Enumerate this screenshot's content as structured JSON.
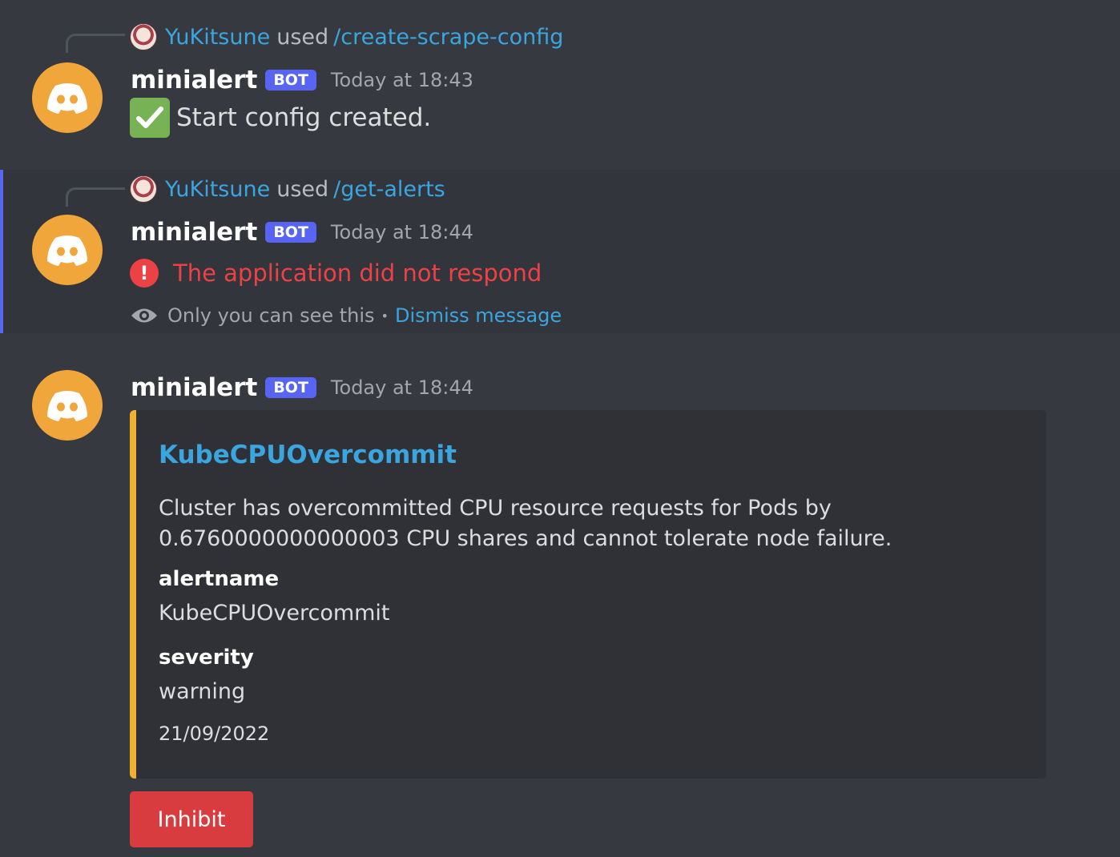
{
  "messages": [
    {
      "reply": {
        "user": "YuKitsune",
        "used": "used",
        "command": "/create-scrape-config"
      },
      "author": "minialert",
      "tag": "BOT",
      "timestamp": "Today at 18:43",
      "content": "Start config created.",
      "content_icon": "white-check-mark"
    },
    {
      "reply": {
        "user": "YuKitsune",
        "used": "used",
        "command": "/get-alerts"
      },
      "author": "minialert",
      "tag": "BOT",
      "timestamp": "Today at 18:44",
      "content": "The application did not respond",
      "content_icon": "exclamation-icon",
      "ephemeral_note": "Only you can see this",
      "ephemeral_bullet": "•",
      "dismiss_label": "Dismiss message"
    },
    {
      "author": "minialert",
      "tag": "BOT",
      "timestamp": "Today at 18:44",
      "embed": {
        "title": "KubeCPUOvercommit",
        "description": "Cluster has overcommitted CPU resource requests for Pods by 0.6760000000000003 CPU shares and cannot tolerate node failure.",
        "fields": [
          {
            "name": "alertname",
            "value": "KubeCPUOvercommit"
          },
          {
            "name": "severity",
            "value": "warning"
          }
        ],
        "footer": "21/09/2022",
        "color": "#f0b132"
      },
      "button_label": "Inhibit"
    }
  ],
  "colors": {
    "background": "#36393f",
    "highlight_background": "#32353b",
    "accent": "#5865f2",
    "link": "#3ba5e0",
    "error": "#ed4245",
    "avatar": "#f0a63b",
    "button_danger": "#d83c3e"
  },
  "icons": [
    "discord-logo-icon",
    "white-check-mark-icon",
    "exclamation-icon",
    "eye-icon"
  ]
}
